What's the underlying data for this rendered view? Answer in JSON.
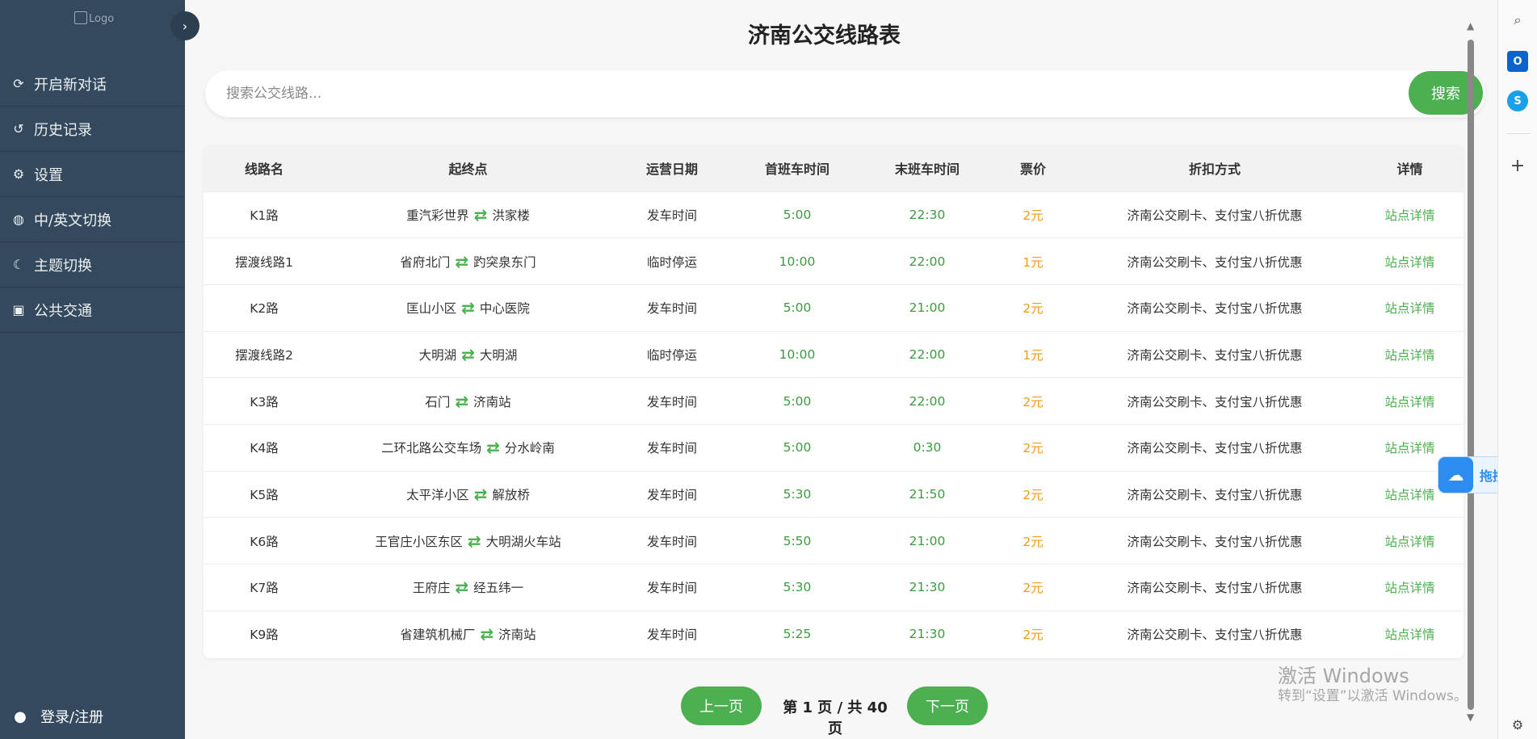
{
  "sidebar": {
    "logo_alt": "Logo",
    "items": [
      {
        "icon": "refresh-icon",
        "label": "开启新对话"
      },
      {
        "icon": "history-icon",
        "label": "历史记录"
      },
      {
        "icon": "gear-icon",
        "label": "设置"
      },
      {
        "icon": "globe-icon",
        "label": "中/英文切换"
      },
      {
        "icon": "moon-icon",
        "label": "主题切换"
      },
      {
        "icon": "bus-icon",
        "label": "公共交通"
      }
    ],
    "login_label": "登录/注册"
  },
  "main": {
    "title": "济南公交线路表",
    "search": {
      "placeholder": "搜索公交线路...",
      "value": "",
      "button_label": "搜索"
    }
  },
  "table": {
    "headers": [
      "线路名",
      "起终点",
      "运营日期",
      "首班车时间",
      "末班车时间",
      "票价",
      "折扣方式",
      "详情"
    ],
    "rows": [
      {
        "name": "K1路",
        "from": "重汽彩世界",
        "to": "洪家楼",
        "status": "发车时间",
        "first": "5:00",
        "last": "22:30",
        "price": "2元",
        "discount": "济南公交刷卡、支付宝八折优惠",
        "detail": "站点详情"
      },
      {
        "name": "摆渡线路1",
        "from": "省府北门",
        "to": "趵突泉东门",
        "status": "临时停运",
        "first": "10:00",
        "last": "22:00",
        "price": "1元",
        "discount": "济南公交刷卡、支付宝八折优惠",
        "detail": "站点详情"
      },
      {
        "name": "K2路",
        "from": "匡山小区",
        "to": "中心医院",
        "status": "发车时间",
        "first": "5:00",
        "last": "21:00",
        "price": "2元",
        "discount": "济南公交刷卡、支付宝八折优惠",
        "detail": "站点详情"
      },
      {
        "name": "摆渡线路2",
        "from": "大明湖",
        "to": "大明湖",
        "status": "临时停运",
        "first": "10:00",
        "last": "22:00",
        "price": "1元",
        "discount": "济南公交刷卡、支付宝八折优惠",
        "detail": "站点详情"
      },
      {
        "name": "K3路",
        "from": "石门",
        "to": "济南站",
        "status": "发车时间",
        "first": "5:00",
        "last": "22:00",
        "price": "2元",
        "discount": "济南公交刷卡、支付宝八折优惠",
        "detail": "站点详情"
      },
      {
        "name": "K4路",
        "from": "二环北路公交车场",
        "to": "分水岭南",
        "status": "发车时间",
        "first": "5:00",
        "last": "0:30",
        "price": "2元",
        "discount": "济南公交刷卡、支付宝八折优惠",
        "detail": "站点详情"
      },
      {
        "name": "K5路",
        "from": "太平洋小区",
        "to": "解放桥",
        "status": "发车时间",
        "first": "5:30",
        "last": "21:50",
        "price": "2元",
        "discount": "济南公交刷卡、支付宝八折优惠",
        "detail": "站点详情"
      },
      {
        "name": "K6路",
        "from": "王官庄小区东区",
        "to": "大明湖火车站",
        "status": "发车时间",
        "first": "5:50",
        "last": "21:00",
        "price": "2元",
        "discount": "济南公交刷卡、支付宝八折优惠",
        "detail": "站点详情"
      },
      {
        "name": "K7路",
        "from": "王府庄",
        "to": "经五纬一",
        "status": "发车时间",
        "first": "5:30",
        "last": "21:30",
        "price": "2元",
        "discount": "济南公交刷卡、支付宝八折优惠",
        "detail": "站点详情"
      },
      {
        "name": "K9路",
        "from": "省建筑机械厂",
        "to": "济南站",
        "status": "发车时间",
        "first": "5:25",
        "last": "21:30",
        "price": "2元",
        "discount": "济南公交刷卡、支付宝八折优惠",
        "detail": "站点详情"
      }
    ]
  },
  "pagination": {
    "prev_label": "上一页",
    "info": "第 1 页 / 共 40 页",
    "next_label": "下一页"
  },
  "watermark": {
    "line1": "激活 Windows",
    "line2": "转到“设置”以激活 Windows。"
  },
  "drag_widget": {
    "label": "拖拽至此,",
    "icon": "cloud-icon"
  },
  "side_panel": {
    "icons": [
      "search-icon",
      "outlook-icon",
      "skype-icon",
      "plus-icon",
      "settings-icon"
    ]
  },
  "colors": {
    "sidebar": "#34495e",
    "accent": "#4caf50",
    "price": "#f39c12",
    "time": "#3d9a3f"
  }
}
